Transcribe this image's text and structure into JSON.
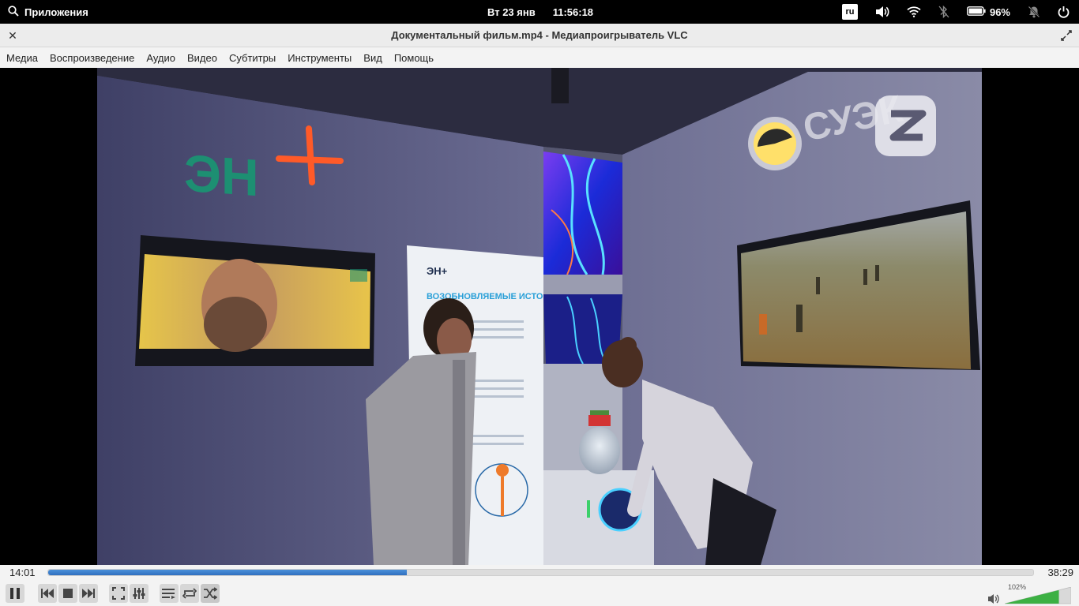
{
  "system_bar": {
    "apps_label": "Приложения",
    "date": "Вт 23 янв",
    "time": "11:56:18",
    "keyboard_layout": "ru",
    "battery": "96%"
  },
  "window": {
    "title": "Документальный фильм.mp4 - Медиапроигрыватель VLC"
  },
  "menu": [
    "Медиа",
    "Воспроизведение",
    "Аудио",
    "Видео",
    "Субтитры",
    "Инструменты",
    "Вид",
    "Помощь"
  ],
  "video": {
    "logo_left": "ЭН",
    "logo_right": "СУЭК",
    "stand_brand": "ЭН+",
    "stand_heading": "ВОЗОБНОВЛЯЕМЫЕ ИСТОЧНИКИ ЭНЕРГИИ"
  },
  "playback": {
    "elapsed": "14:01",
    "duration": "38:29",
    "progress": 0.364,
    "volume_label": "102%",
    "volume": 1.02
  },
  "colors": {
    "accent": "#2f6fbf",
    "volume_green": "#3cb043"
  }
}
